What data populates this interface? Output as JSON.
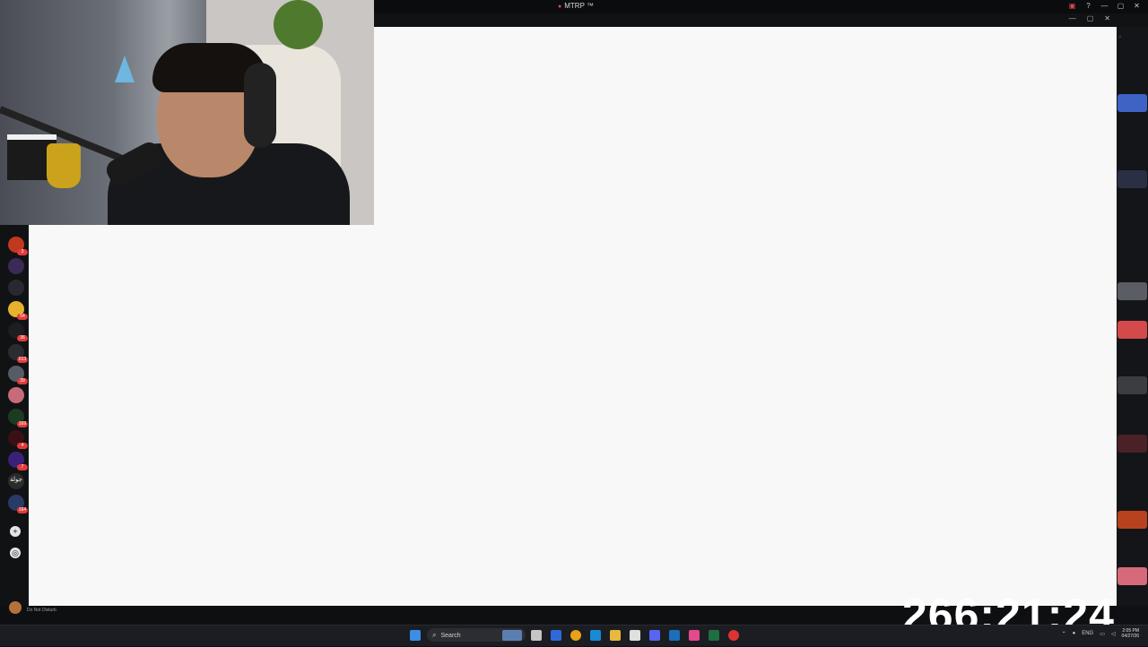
{
  "window": {
    "title": "MTRP ™",
    "top_icons": [
      "notification-icon",
      "help-icon",
      "minimize-icon",
      "maximize-icon",
      "close-icon"
    ]
  },
  "inner_window_controls": [
    "—",
    "▢",
    "✕"
  ],
  "servers": [
    {
      "name": "server-1",
      "badge": "3",
      "color": "#c2381f"
    },
    {
      "name": "server-2",
      "badge": "",
      "color": "#3b2a55"
    },
    {
      "name": "server-3",
      "badge": "",
      "color": "#27292f"
    },
    {
      "name": "server-4",
      "badge": "54",
      "color": "#e6b12d"
    },
    {
      "name": "server-5",
      "badge": "36",
      "color": "#1d1e22"
    },
    {
      "name": "server-6",
      "badge": "613",
      "color": "#2a2c31"
    },
    {
      "name": "server-7",
      "badge": "39",
      "color": "#545c66"
    },
    {
      "name": "server-8",
      "badge": "",
      "color": "#c76a7a"
    },
    {
      "name": "server-9",
      "badge": "169",
      "color": "#1b3b22"
    },
    {
      "name": "server-10",
      "badge": "4",
      "color": "#3a1014"
    },
    {
      "name": "server-11",
      "badge": "7",
      "color": "#3b2078"
    },
    {
      "name": "server-12",
      "badge": "",
      "color": "#2b2b2b",
      "label": "جولة"
    },
    {
      "name": "server-13",
      "badge": "164",
      "color": "#2a3a66"
    }
  ],
  "user": {
    "status": "Do Not Disturb"
  },
  "timer": "266:21:24",
  "taskbar": {
    "search_label": "Search",
    "language": "ENG",
    "time": "2:05 PM",
    "date": "04/27/26"
  }
}
